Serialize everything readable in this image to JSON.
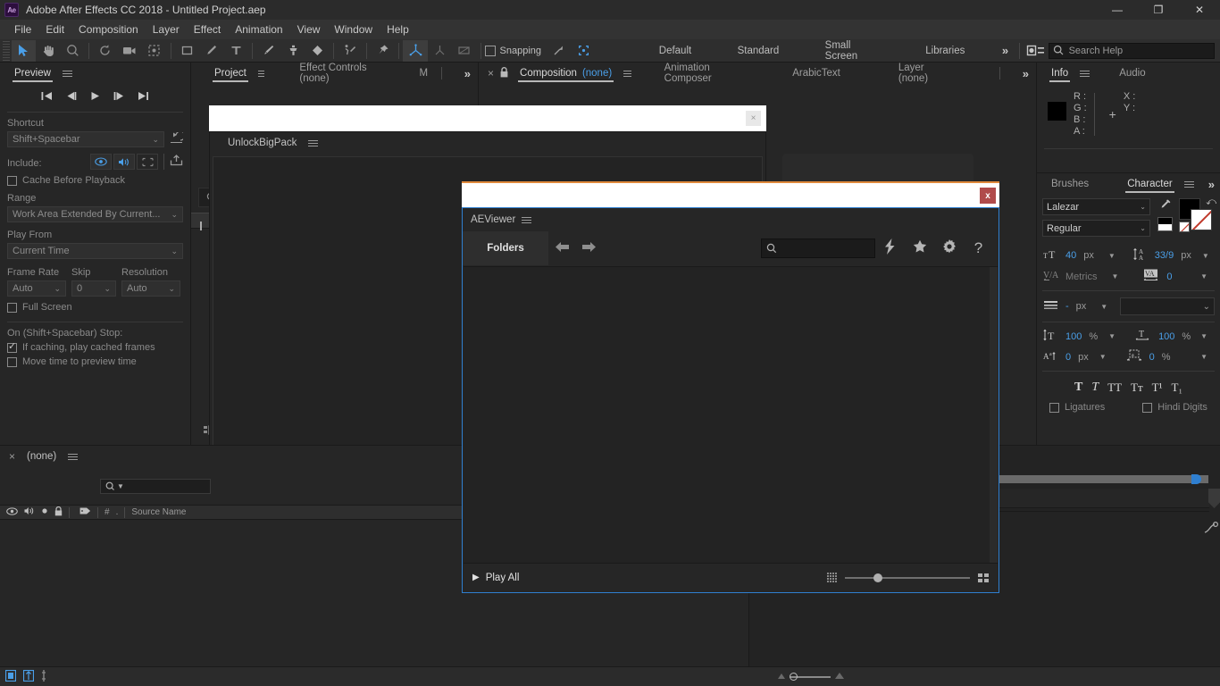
{
  "titlebar": {
    "logo": "Ae",
    "title": "Adobe After Effects CC 2018 - Untitled Project.aep",
    "minimize": "—",
    "maximize": "❐",
    "close": "✕"
  },
  "menubar": {
    "items": [
      "File",
      "Edit",
      "Composition",
      "Layer",
      "Effect",
      "Animation",
      "View",
      "Window",
      "Help"
    ]
  },
  "toolbar": {
    "snapping_label": "Snapping",
    "workspaces": [
      "Default",
      "Standard",
      "Small Screen",
      "Libraries"
    ],
    "overflow": "»",
    "search_placeholder": "Search Help"
  },
  "preview": {
    "tab": "Preview",
    "shortcut_label": "Shortcut",
    "shortcut_value": "Shift+Spacebar",
    "include_label": "Include:",
    "cache_before_playback": "Cache Before Playback",
    "range_label": "Range",
    "range_value": "Work Area Extended By Current...",
    "play_from_label": "Play From",
    "play_from_value": "Current Time",
    "frame_rate_label": "Frame Rate",
    "skip_label": "Skip",
    "resolution_label": "Resolution",
    "frame_rate_value": "Auto",
    "skip_value": "0",
    "resolution_value": "Auto",
    "full_screen": "Full Screen",
    "on_stop_label": "On (Shift+Spacebar) Stop:",
    "if_caching": "If caching, play cached frames",
    "move_time": "Move time to preview time"
  },
  "project_tabs": {
    "project": "Project",
    "effect_controls": "Effect Controls (none)",
    "truncated": "M",
    "overflow": "»"
  },
  "center_tabs": {
    "close": "×",
    "lock_icon": "lock-icon",
    "composition": "Composition",
    "composition_value": "(none)",
    "animation_composer": "Animation Composer",
    "arabic_text": "ArabicText",
    "layer": "Layer  (none)",
    "overflow": "»"
  },
  "unlock": {
    "tab": "UnlockBigPack",
    "close": "×"
  },
  "aeviewer": {
    "close": "x",
    "tab": "AEViewer",
    "folders": "Folders",
    "back": "←",
    "forward": "→",
    "search_placeholder": "",
    "icons": [
      "lightning-icon",
      "star-icon",
      "gear-icon",
      "help-icon"
    ],
    "help": "?",
    "play_all": "Play All",
    "play_triangle": "▶"
  },
  "info": {
    "tab": "Info",
    "audio_tab": "Audio",
    "channels": [
      "R :",
      "G :",
      "B :",
      "A :"
    ],
    "coords": [
      "X :",
      "Y :"
    ]
  },
  "character": {
    "brushes_tab": "Brushes",
    "tab": "Character",
    "overflow": "»",
    "font_family": "Lalezar",
    "font_style": "Regular",
    "font_size": "40",
    "font_size_unit": "px",
    "leading": "33/9",
    "leading_unit": "px",
    "kerning": "Metrics",
    "tracking": "0",
    "stroke_width": "-",
    "stroke_width_unit": "px",
    "stroke_style": "",
    "vertical_scale": "100",
    "vertical_scale_unit": "%",
    "horizontal_scale": "100",
    "horizontal_scale_unit": "%",
    "baseline_shift": "0",
    "baseline_shift_unit": "px",
    "tsume": "0",
    "tsume_unit": "%",
    "styles": [
      "T",
      "T",
      "TT",
      "Tт",
      "T¹",
      "T₁"
    ],
    "ligatures": "Ligatures",
    "hindi_digits": "Hindi Digits"
  },
  "timeline": {
    "close": "×",
    "title": "(none)",
    "search_icon": "search-icon",
    "columns": [
      "eye-icon",
      "audio-icon",
      "solo-icon",
      "lock-icon",
      "label-icon",
      "#",
      ".",
      "Source Name"
    ],
    "source_name": "Source Name",
    "hash": "#"
  },
  "colors": {
    "accent_blue": "#4a9fe8",
    "panel_bg": "#262626",
    "toolbar_bg": "#2e2e2e",
    "dialog_border": "#2f7fd0",
    "orange_border": "#e08a3c",
    "close_red": "#b04b4b"
  }
}
